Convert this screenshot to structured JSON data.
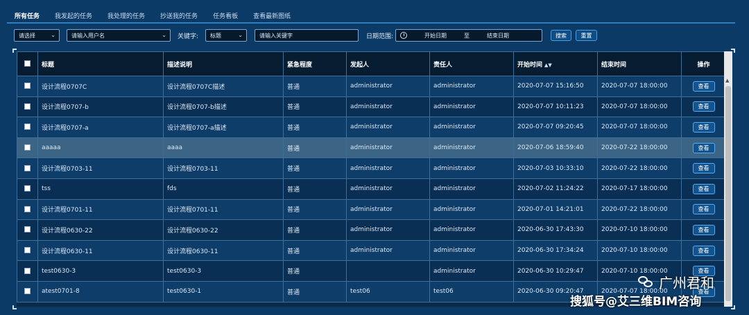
{
  "tabs": [
    {
      "label": "所有任务",
      "active": true
    },
    {
      "label": "我发起的任务",
      "active": false
    },
    {
      "label": "我处理的任务",
      "active": false
    },
    {
      "label": "抄送我的任务",
      "active": false
    },
    {
      "label": "任务看板",
      "active": false
    },
    {
      "label": "查看最新图纸",
      "active": false
    }
  ],
  "filters": {
    "select_value": "请选择",
    "user_placeholder": "请输入用户名",
    "keyword_label": "关键字:",
    "keyword_field": "标题",
    "keyword_placeholder": "请输入关键字",
    "date_label": "日期范围:",
    "date_start": "开始日期",
    "date_sep": "至",
    "date_end": "结束日期",
    "search_label": "搜索",
    "reset_label": "重置"
  },
  "table": {
    "columns": [
      "标题",
      "描述说明",
      "紧急程度",
      "发起人",
      "责任人",
      "开始时间",
      "结束时间",
      "操作"
    ],
    "view_label": "查看",
    "rows": [
      [
        "设计流程0707C",
        "设计流程0707C描述",
        "普通",
        "administrator",
        "administrator",
        "2020-07-07 15:16:50",
        "2020-07-07 18:00:00"
      ],
      [
        "设计流程0707-b",
        "设计流程0707-b描述",
        "普通",
        "administrator",
        "administrator",
        "2020-07-07 10:11:23",
        "2020-07-07 18:00:00"
      ],
      [
        "设计流程0707-a",
        "设计流程0707-a描述",
        "普通",
        "administrator",
        "administrator",
        "2020-07-07 09:20:45",
        "2020-07-07 18:00:00"
      ],
      [
        "aaaaa",
        "aaaa",
        "普通",
        "administrator",
        "administrator",
        "2020-07-06 18:59:40",
        "2020-07-22 18:00:00"
      ],
      [
        "设计流程0703-11",
        "设计流程0703-11",
        "普通",
        "administrator",
        "administrator",
        "2020-07-03 10:33:10",
        "2020-07-22 18:00:00"
      ],
      [
        "tss",
        "fds",
        "普通",
        "administrator",
        "administrator",
        "2020-07-02 11:24:22",
        "2020-07-17 18:00:00"
      ],
      [
        "设计流程0701-11",
        "设计流程0701-11",
        "普通",
        "administrator",
        "administrator",
        "2020-07-01 14:21:01",
        "2020-07-22 18:00:00"
      ],
      [
        "设计流程0630-22",
        "设计流程0630-22",
        "普通",
        "administrator",
        "administrator",
        "2020-06-30 17:43:30",
        "2020-07-10 18:00:00"
      ],
      [
        "设计流程0630-11",
        "设计流程0630-11",
        "普通",
        "administrator",
        "administrator",
        "2020-06-30 17:34:24",
        "2020-07-10 18:00:00"
      ],
      [
        "test0630-3",
        "test0630-3",
        "普通",
        "",
        "administrator",
        "2020-06-30 10:29:47",
        "2020-07-10 18:00:00"
      ],
      [
        "atest0701-8",
        "test0630-1",
        "普通",
        "test06",
        "test06",
        "2020-06-30 09:20:47",
        "2020-07-07 18:00:00"
      ]
    ]
  },
  "watermark": {
    "top": "广州君和",
    "bottom": "搜狐号@艾三维BIM咨询"
  },
  "icons": {
    "sort": "sort-icon",
    "clock": "clock-icon",
    "chevron": "chevron-down-icon",
    "wechat": "wechat-icon"
  },
  "colors": {
    "background": "#0b3a66",
    "header": "#061c31",
    "row": "#0f3d6a",
    "row_alt": "#0a2f54",
    "row_highlight": "#3c6585",
    "accent": "#2f7fc0"
  }
}
